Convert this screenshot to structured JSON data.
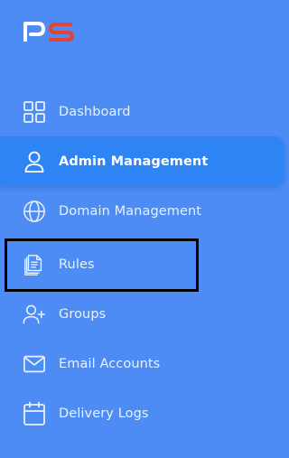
{
  "app": {
    "logo_text": "PS",
    "logo_colors": {
      "p": "#ffffff",
      "s": "#e8432f"
    }
  },
  "nav": {
    "items": [
      {
        "label": "Dashboard",
        "icon": "dashboard-grid-icon",
        "active": false
      },
      {
        "label": "Admin Management",
        "icon": "user-icon",
        "active": true
      },
      {
        "label": "Domain Management",
        "icon": "globe-icon",
        "active": false
      },
      {
        "label": "Rules",
        "icon": "documents-icon",
        "active": false,
        "highlighted": true
      },
      {
        "label": "Groups",
        "icon": "user-add-icon",
        "active": false
      },
      {
        "label": "Email Accounts",
        "icon": "mail-icon",
        "active": false
      },
      {
        "label": "Delivery Logs",
        "icon": "calendar-icon",
        "active": false
      }
    ]
  },
  "colors": {
    "sidebar_bg": "#4d8cf5",
    "active_bg": "#2f84f3",
    "text": "#e9f1ff",
    "highlight_border": "#000000"
  }
}
